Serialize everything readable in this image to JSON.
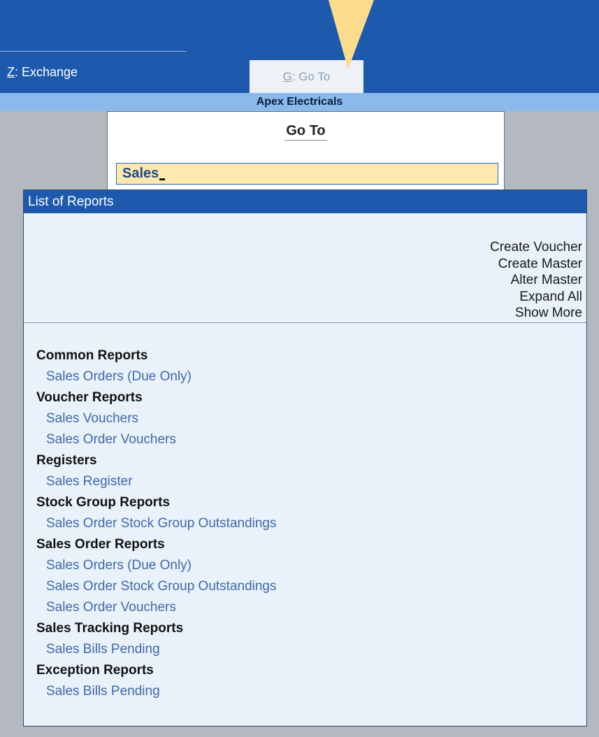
{
  "topbar": {
    "exchange_key": "Z",
    "exchange_label": ": Exchange",
    "goto_key": "G",
    "goto_label": ": Go To"
  },
  "company": {
    "name": "Apex Electricals"
  },
  "goto_panel": {
    "title": "Go To",
    "search_value": "Sales"
  },
  "list": {
    "header": "List of Reports",
    "actions": [
      "Create Voucher",
      "Create Master",
      "Alter Master",
      "Expand All",
      "Show More"
    ],
    "groups": [
      {
        "title": "Common Reports",
        "items": [
          "Sales Orders (Due Only)"
        ]
      },
      {
        "title": "Voucher Reports",
        "items": [
          "Sales Vouchers",
          "Sales Order Vouchers"
        ]
      },
      {
        "title": "Registers",
        "items": [
          "Sales Register"
        ]
      },
      {
        "title": "Stock Group Reports",
        "items": [
          "Sales Order Stock Group Outstandings"
        ]
      },
      {
        "title": "Sales Order Reports",
        "items": [
          "Sales Orders (Due Only)",
          "Sales Order Stock Group Outstandings",
          "Sales Order Vouchers"
        ]
      },
      {
        "title": "Sales Tracking Reports",
        "items": [
          "Sales Bills Pending"
        ]
      },
      {
        "title": "Exception Reports",
        "items": [
          "Sales Bills Pending"
        ]
      }
    ]
  },
  "colors": {
    "topbar": "#1d5aad",
    "company_bar": "#8ab9ec",
    "search_bg": "#fde8ad",
    "link": "#3f69a8",
    "pointer": "#fbdc8d"
  }
}
